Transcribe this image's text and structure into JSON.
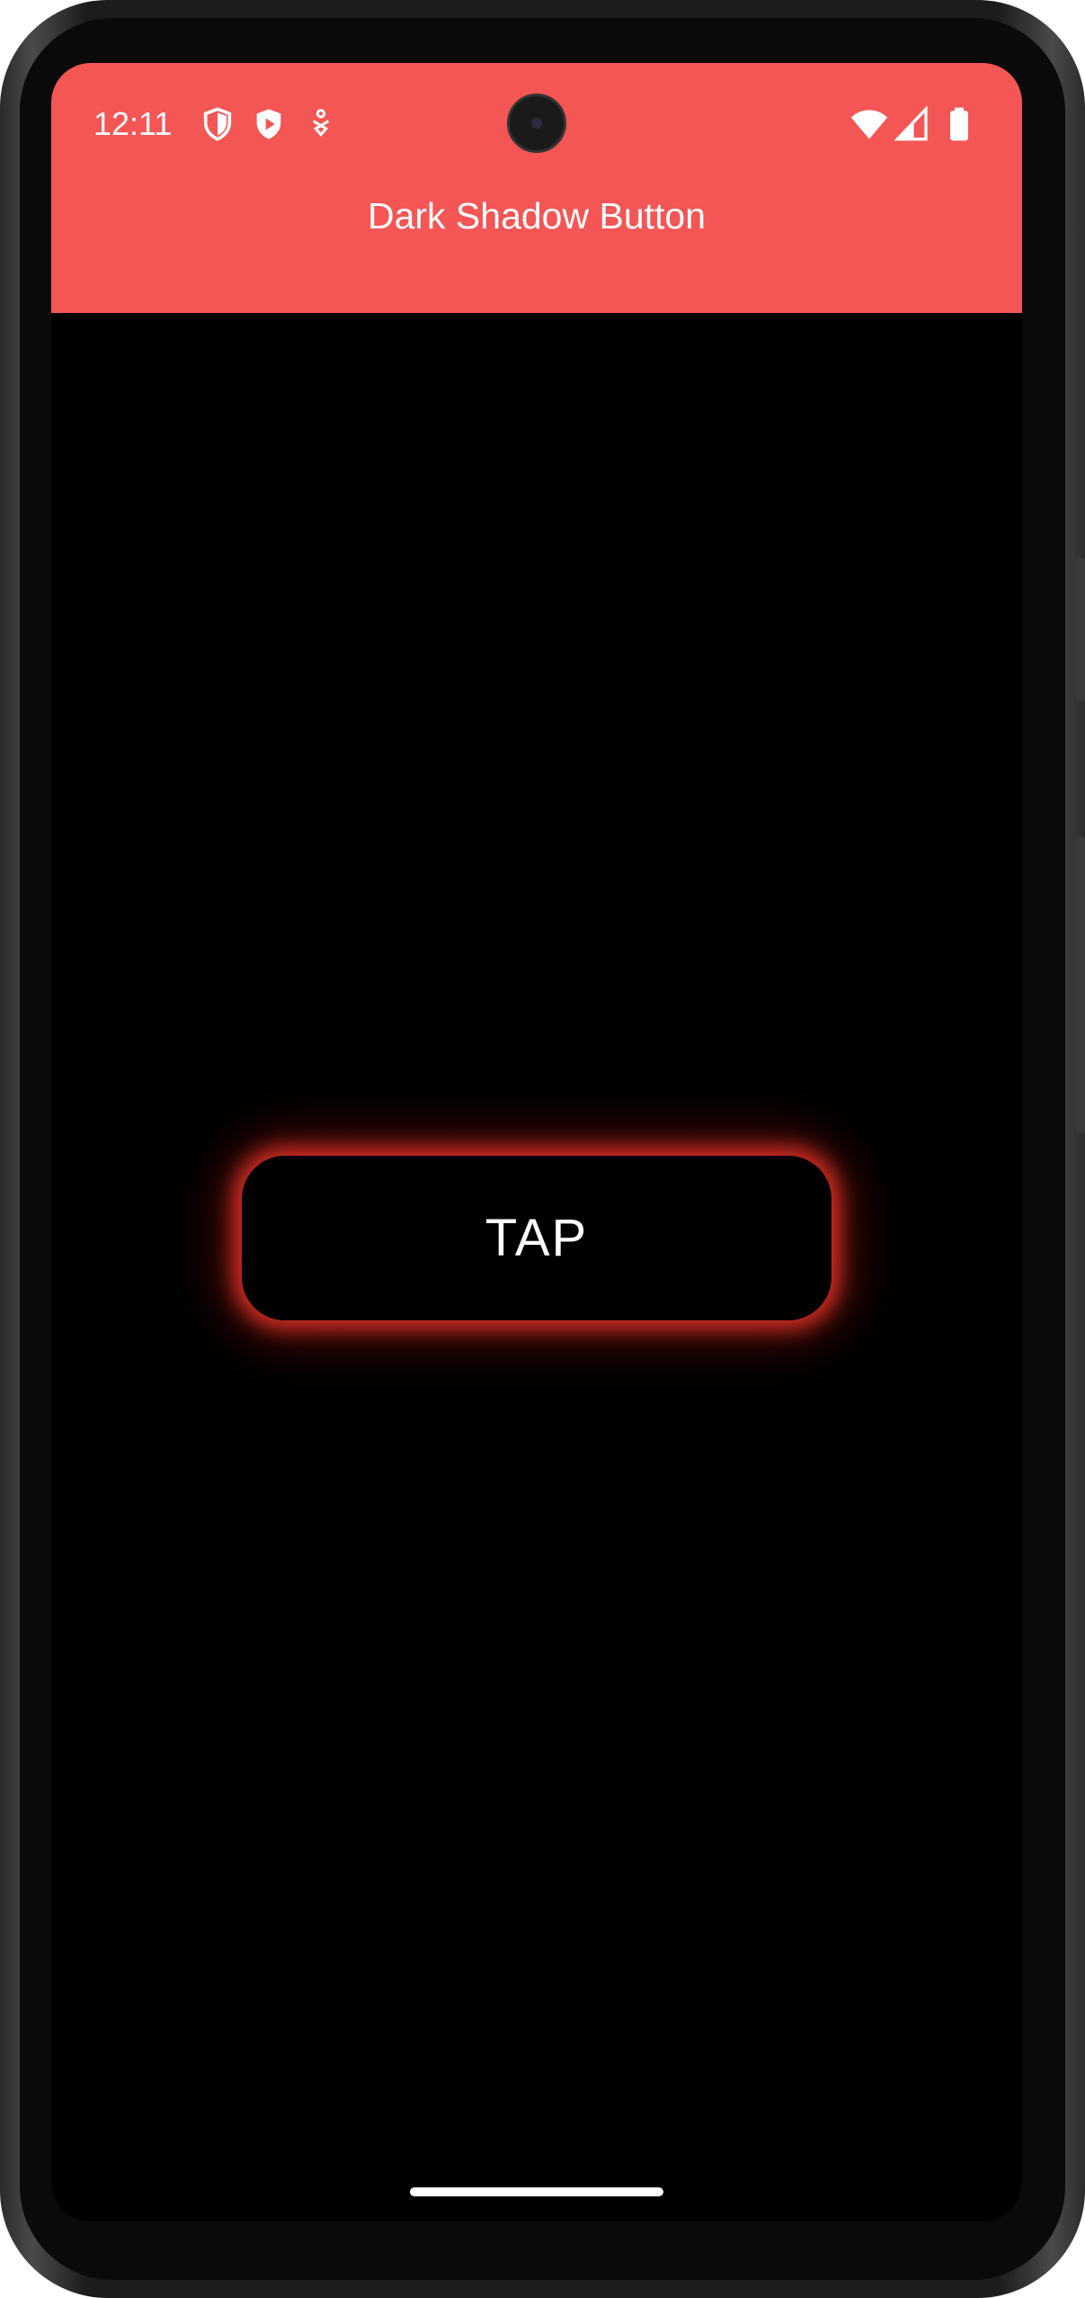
{
  "status_bar": {
    "time": "12:11",
    "left_icons": [
      "shield-outline-icon",
      "shield-play-icon",
      "accessibility-icon"
    ],
    "right_icons": [
      "wifi-icon",
      "cellular-signal-icon",
      "battery-icon"
    ]
  },
  "app_bar": {
    "title": "Dark Shadow Button",
    "color": "#f45555"
  },
  "main": {
    "button_label": "TAP",
    "button_glow_color": "#e63228",
    "background_color": "#000000"
  }
}
